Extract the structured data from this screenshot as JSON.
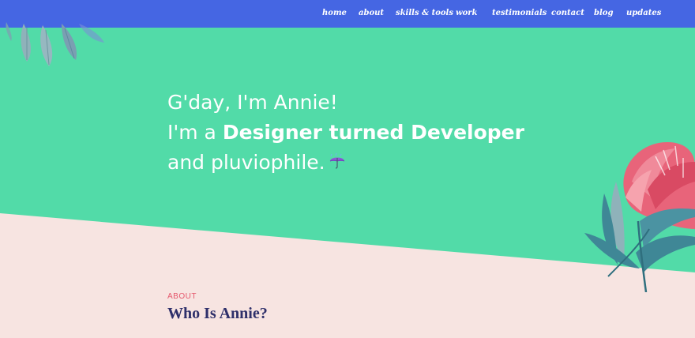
{
  "nav": {
    "items": [
      {
        "label": "home"
      },
      {
        "label": "about"
      },
      {
        "label": "skills & tools"
      },
      {
        "label": "work"
      },
      {
        "label": "testimonials"
      },
      {
        "label": "contact"
      },
      {
        "label": "blog"
      },
      {
        "label": "updates"
      }
    ]
  },
  "hero": {
    "line1": "G'day, I'm Annie!",
    "line2_prefix": "I'm a ",
    "line2_bold": "Designer turned Developer",
    "line3": "and pluviophile.",
    "emoji_icon": "umbrella-with-rain-icon"
  },
  "about": {
    "label": "ABOUT",
    "title": "Who Is Annie?"
  },
  "colors": {
    "nav_bg": "#4566e3",
    "hero_bg": "#52dba8",
    "page_bg": "#f7e4e1",
    "accent_label": "#e5566b",
    "title_text": "#2e2f6a"
  }
}
